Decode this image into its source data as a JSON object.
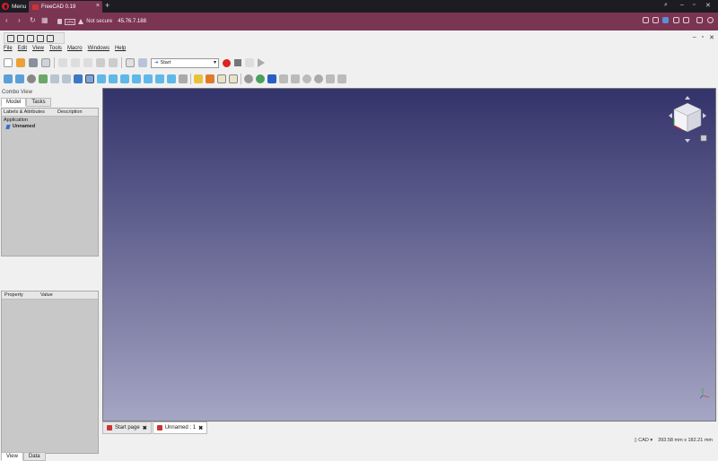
{
  "browser": {
    "menu_label": "Menu",
    "tab_title": "FreeCAD 0.19",
    "tab_close": "×",
    "new_tab": "+",
    "security_text": "Not secure",
    "vpn_badge": "VPN",
    "url": "45.76.7.188"
  },
  "app": {
    "menu": [
      "File",
      "Edit",
      "View",
      "Tools",
      "Macro",
      "Windows",
      "Help"
    ],
    "workbench": "Start",
    "combo_view_title": "Combo View",
    "combo_tabs": [
      "Model",
      "Tasks"
    ],
    "tree_headers": [
      "Labels & Attributes",
      "Description"
    ],
    "tree_root": "Application",
    "tree_doc": "Unnamed",
    "prop_headers": [
      "Property",
      "Value"
    ],
    "bottom_tabs": [
      "View",
      "Data"
    ],
    "doc_tabs": [
      "Start page",
      "Unnamed : 1"
    ],
    "doc_tab_close": "✖",
    "status_nav": "CAD",
    "status_dims": "393.58 mm x 182.21 mm"
  },
  "colors": {
    "browser_accent": "#7a3553",
    "view_top": "#33336b",
    "view_bottom": "#a5a5c4"
  }
}
